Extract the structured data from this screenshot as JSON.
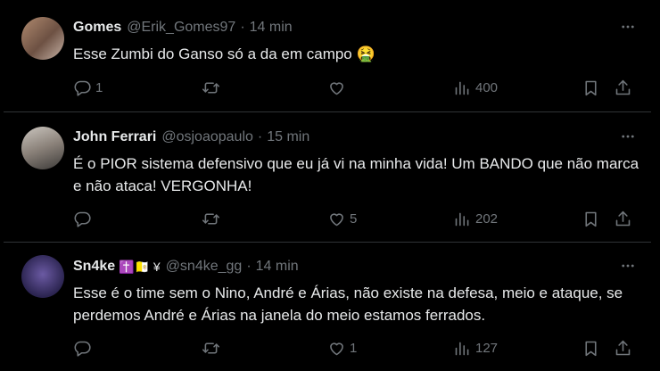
{
  "tweets": [
    {
      "name": "Gomes",
      "handle": "@Erik_Gomes97",
      "separator": "·",
      "time": "14 min",
      "badges": "",
      "text": "Esse Zumbi do Ganso só a da em campo 🤮",
      "replies": "1",
      "retweets": "",
      "likes": "",
      "views": "400"
    },
    {
      "name": "John Ferrari",
      "handle": "@osjoaopaulo",
      "separator": "·",
      "time": "15 min",
      "badges": "",
      "text": "É o PIOR sistema defensivo que eu já vi na minha vida! Um BANDO que não marca e não ataca! VERGONHA!",
      "replies": "",
      "retweets": "",
      "likes": "5",
      "views": "202"
    },
    {
      "name": "Sn4ke",
      "handle": "@sn4ke_gg",
      "separator": "·",
      "time": "14 min",
      "badges": "✝️🇻🇦 ¥",
      "text": "Esse é o time sem o Nino, André e Árias, não existe na defesa, meio e ataque, se perdemos André e Árias na janela do meio estamos ferrados.",
      "replies": "",
      "retweets": "",
      "likes": "1",
      "views": "127"
    }
  ],
  "colors": {
    "background": "#000000",
    "text": "#e7e9ea",
    "muted": "#71767b",
    "divider": "#2f3336"
  },
  "icons": [
    "more-icon",
    "reply-icon",
    "retweet-icon",
    "like-icon",
    "views-icon",
    "bookmark-icon",
    "share-icon"
  ]
}
